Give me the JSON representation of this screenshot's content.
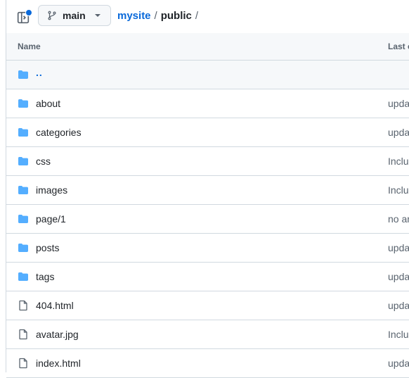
{
  "header": {
    "branch": "main",
    "breadcrumb": {
      "repo": "mysite",
      "path": "public",
      "separator": "/"
    }
  },
  "columns": {
    "name": "Name",
    "last_commit": "Last c"
  },
  "parent_row": {
    "label": ".."
  },
  "rows": [
    {
      "name": "about",
      "type": "folder",
      "message": "upda"
    },
    {
      "name": "categories",
      "type": "folder",
      "message": "upda"
    },
    {
      "name": "css",
      "type": "folder",
      "message": "Inclu"
    },
    {
      "name": "images",
      "type": "folder",
      "message": "Inclu"
    },
    {
      "name": "page/1",
      "type": "folder",
      "message": "no ar"
    },
    {
      "name": "posts",
      "type": "folder",
      "message": "upda"
    },
    {
      "name": "tags",
      "type": "folder",
      "message": "upda"
    },
    {
      "name": "404.html",
      "type": "file",
      "message": "upda"
    },
    {
      "name": "avatar.jpg",
      "type": "file",
      "message": "Inclu"
    },
    {
      "name": "index.html",
      "type": "file",
      "message": "upda"
    }
  ],
  "colors": {
    "accent": "#0969da",
    "folder": "#54aeff",
    "border": "#d1d9e0",
    "muted": "#59636e"
  },
  "icons": {
    "tree_toggle": "sidebar-expand-icon",
    "branch": "git-branch-icon",
    "caret": "triangle-down-icon",
    "folder": "folder-icon",
    "file": "file-icon"
  }
}
